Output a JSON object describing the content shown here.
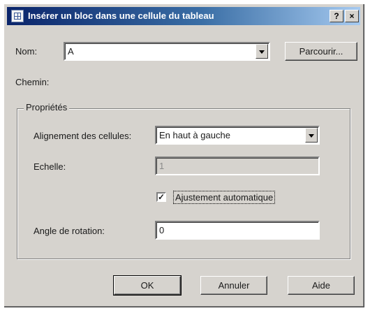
{
  "window": {
    "title": "Insérer un bloc dans une cellule du tableau",
    "help_glyph": "?",
    "close_glyph": "×"
  },
  "name": {
    "label": "Nom:",
    "value": "A",
    "browse_label": "Parcourir..."
  },
  "path": {
    "label": "Chemin:"
  },
  "properties": {
    "title": "Propriétés",
    "alignment_label": "Alignement des cellules:",
    "alignment_value": "En haut à gauche",
    "scale_label": "Echelle:",
    "scale_value": "1",
    "autofit_checked": true,
    "autofit_check_glyph": "✓",
    "autofit_label": "Ajustement automatique",
    "rotation_label": "Angle de rotation:",
    "rotation_value": "0"
  },
  "buttons": {
    "ok": "OK",
    "cancel": "Annuler",
    "help": "Aide"
  }
}
